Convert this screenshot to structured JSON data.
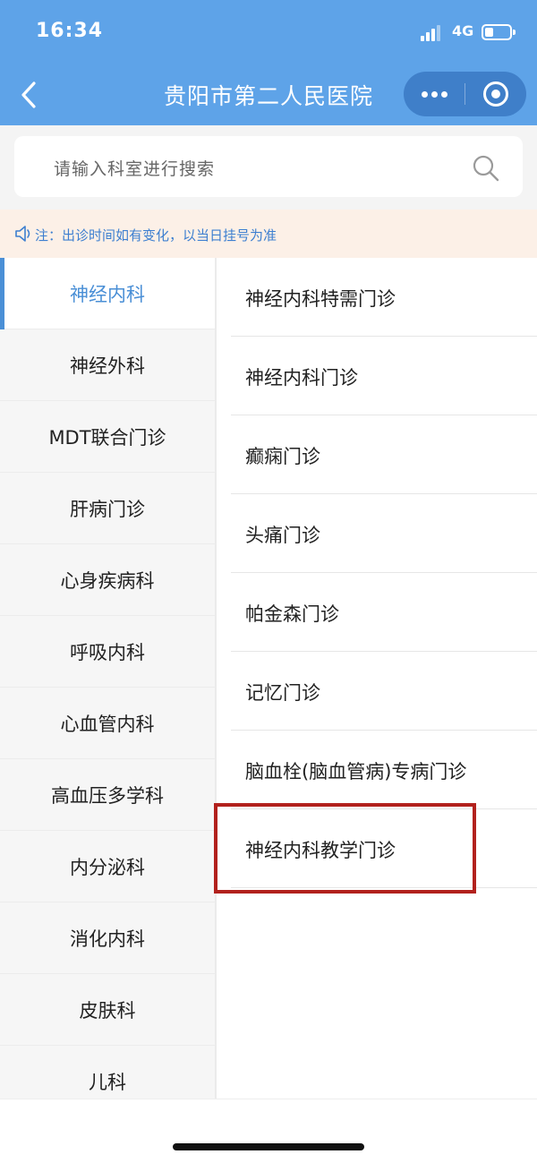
{
  "status_bar": {
    "time": "16:34",
    "network": "4G"
  },
  "nav": {
    "title": "贵阳市第二人民医院",
    "back_icon": "chevron-left-icon",
    "more_icon": "more-dots-icon",
    "close_icon": "target-circle-icon"
  },
  "search": {
    "placeholder": "请输入科室进行搜索",
    "icon": "search-icon"
  },
  "notice": {
    "text": "注：出诊时间如有变化，以当日挂号为准",
    "icon": "speaker-icon"
  },
  "colors": {
    "nav_bg": "#5ea3e8",
    "accent": "#4a8fd6",
    "highlight_border": "#b2211d",
    "notice_bg": "#fcf0e7"
  },
  "departments": {
    "selected": "神经内科",
    "items": [
      {
        "label": "神经内科"
      },
      {
        "label": "神经外科"
      },
      {
        "label": "MDT联合门诊"
      },
      {
        "label": "肝病门诊"
      },
      {
        "label": "心身疾病科"
      },
      {
        "label": "呼吸内科"
      },
      {
        "label": "心血管内科"
      },
      {
        "label": "高血压多学科"
      },
      {
        "label": "内分泌科"
      },
      {
        "label": "消化内科"
      },
      {
        "label": "皮肤科"
      },
      {
        "label": "儿科"
      }
    ]
  },
  "clinics": {
    "items": [
      {
        "label": "神经内科特需门诊"
      },
      {
        "label": "神经内科门诊"
      },
      {
        "label": "癫痫门诊"
      },
      {
        "label": "头痛门诊"
      },
      {
        "label": "帕金森门诊"
      },
      {
        "label": "记忆门诊"
      },
      {
        "label": "脑血栓(脑血管病)专病门诊"
      },
      {
        "label": "神经内科教学门诊"
      }
    ],
    "highlighted": "神经内科教学门诊"
  }
}
